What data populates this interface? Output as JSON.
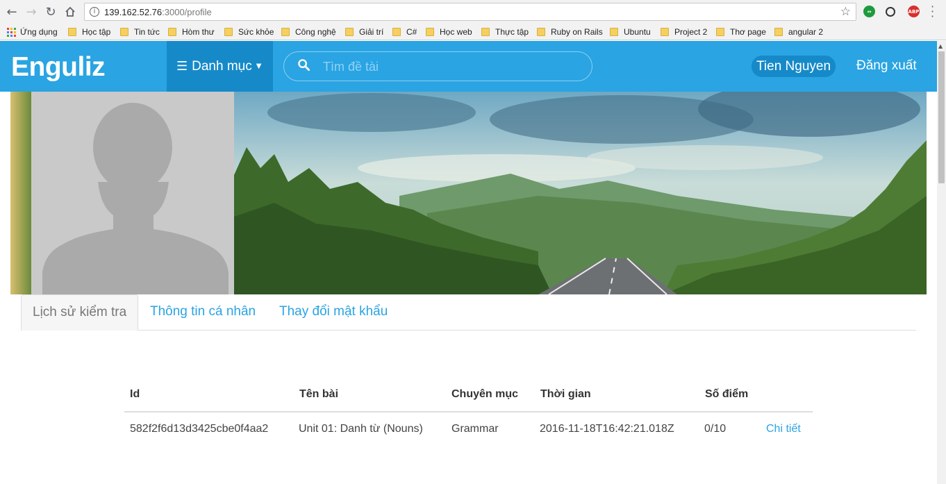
{
  "browser": {
    "url_host": "139.162.52.76",
    "url_rest": ":3000/profile",
    "bookmarks": [
      "Ứng dụng",
      "Học tập",
      "Tin tức",
      "Hòm thư",
      "Sức khỏe",
      "Công nghệ",
      "Giải trí",
      "C#",
      "Học web",
      "Thực tập",
      "Ruby on Rails",
      "Ubuntu",
      "Project 2",
      "Thơ page",
      "angular 2"
    ],
    "ext_abp": "ABP"
  },
  "navbar": {
    "brand": "Enguliz",
    "menu_label": "Danh mục",
    "search_placeholder": "Tìm đề tài",
    "user_name": "Tien Nguyen",
    "logout": "Đăng xuất",
    "color": "#2aa4e2",
    "accent_dark": "#168ac9"
  },
  "tabs": [
    {
      "label": "Lịch sử kiểm tra",
      "active": true
    },
    {
      "label": "Thông tin cá nhân",
      "active": false
    },
    {
      "label": "Thay đổi mật khẩu",
      "active": false
    }
  ],
  "table": {
    "headers": [
      "Id",
      "Tên bài",
      "Chuyên mục",
      "Thời gian",
      "Số điểm"
    ],
    "rows": [
      {
        "id": "582f2f6d13d3425cbe0f4aa2",
        "title": "Unit 01: Danh từ (Nouns)",
        "category": "Grammar",
        "time": "2016-11-18T16:42:21.018Z",
        "score": "0/10",
        "action": "Chi tiết"
      }
    ]
  }
}
